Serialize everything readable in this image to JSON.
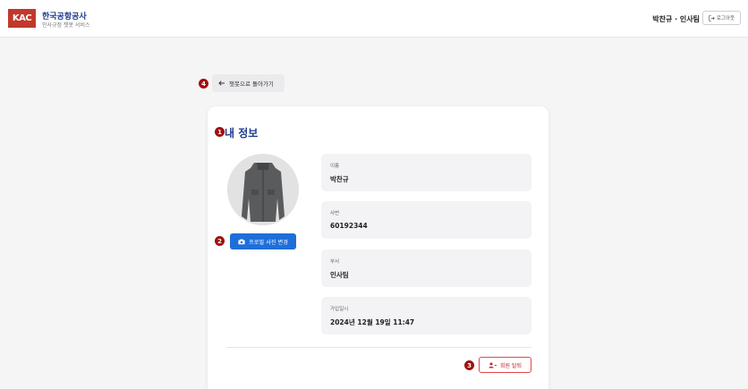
{
  "header": {
    "logo_text": "KAC",
    "brand_title": "한국공항공사",
    "brand_subtitle": "인사규정 챗봇 서비스",
    "user_info": "박찬규 · 인사팀",
    "logout_label": "로그아웃",
    "logout_icon": "logout-icon"
  },
  "back_button": {
    "label": "챗봇으로 돌아가기",
    "icon": "arrow-left-icon"
  },
  "profile": {
    "title": "내 정보",
    "photo_button_label": "프로필 사진 변경",
    "photo_button_icon": "camera-icon",
    "fields": [
      {
        "label": "이름",
        "value": "박찬규"
      },
      {
        "label": "사번",
        "value": "60192344"
      },
      {
        "label": "부서",
        "value": "인사팀"
      },
      {
        "label": "가입일시",
        "value": "2024년 12월 19일 11:47"
      }
    ],
    "withdraw_label": "회원 탈퇴",
    "withdraw_icon": "user-remove-icon"
  },
  "markers": [
    "1",
    "2",
    "3",
    "4"
  ],
  "colors": {
    "brand_red": "#c0392b",
    "brand_navy": "#1d3c8f",
    "primary_blue": "#1e6fd9",
    "danger": "#c82333",
    "marker": "#a01010"
  }
}
